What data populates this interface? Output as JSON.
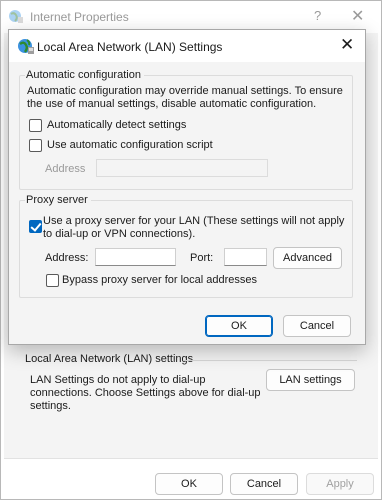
{
  "parent": {
    "title": "Internet Properties",
    "help_label": "?",
    "close_label": "✕",
    "lan_group_title": "Local Area Network (LAN) settings",
    "lan_desc": "LAN Settings do not apply to dial-up connections. Choose Settings above for dial-up settings.",
    "lan_settings_button": "LAN settings",
    "ok_button": "OK",
    "cancel_button": "Cancel",
    "apply_button": "Apply"
  },
  "dialog": {
    "title": "Local Area Network (LAN) Settings",
    "close_label": "✕",
    "auto_config": {
      "legend": "Automatic configuration",
      "description": "Automatic configuration may override manual settings.  To ensure the use of manual settings, disable automatic configuration.",
      "auto_detect_label": "Automatically detect settings",
      "auto_detect_checked": false,
      "use_script_label": "Use automatic configuration script",
      "use_script_checked": false,
      "address_label": "Address",
      "address_value": ""
    },
    "proxy": {
      "legend": "Proxy server",
      "use_proxy_label": "Use a proxy server for your LAN (These settings will not apply to dial-up or VPN connections).",
      "use_proxy_checked": true,
      "address_label": "Address:",
      "address_value": "",
      "port_label": "Port:",
      "port_value": "",
      "advanced_button": "Advanced",
      "bypass_label": "Bypass proxy server for local addresses",
      "bypass_checked": false
    },
    "ok_button": "OK",
    "cancel_button": "Cancel"
  },
  "colors": {
    "accent": "#0067c0",
    "window_bg": "#f4f4f4",
    "disabled_text": "#9a9a9a"
  },
  "icons": {
    "window_icon": "internet-globe-icon",
    "close_icon": "close-icon",
    "help_icon": "help-icon",
    "checkmark_icon": "checkmark-icon"
  }
}
